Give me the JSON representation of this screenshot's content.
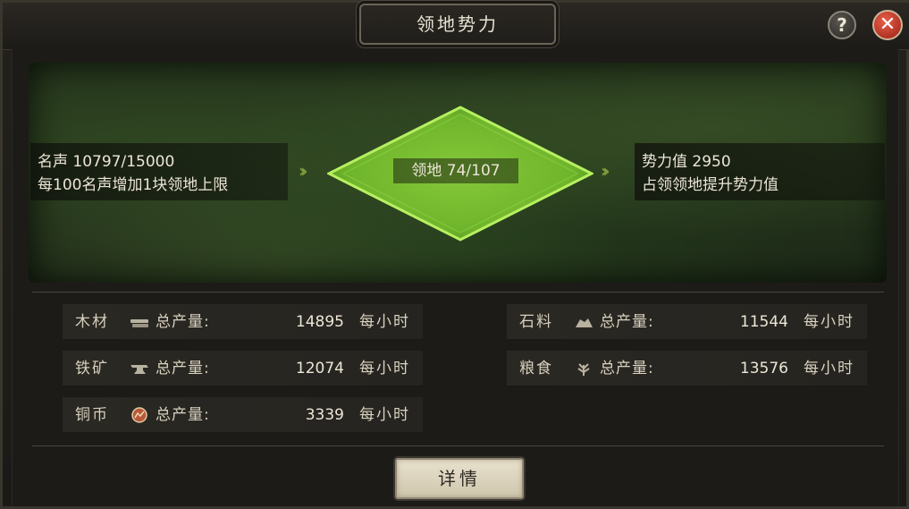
{
  "window": {
    "title": "领地势力",
    "help_label": "?",
    "close_label": "✕"
  },
  "reputation": {
    "line1": "名声 10797/15000",
    "line2": "每100名声增加1块领地上限"
  },
  "territory": {
    "label": "领地 74/107"
  },
  "power": {
    "line1": "势力值 2950",
    "line2": "占领领地提升势力值"
  },
  "resources": [
    {
      "name": "木材",
      "icon": "wood-icon",
      "label": "总产量:",
      "value": "14895",
      "unit": "每小时"
    },
    {
      "name": "石料",
      "icon": "stone-icon",
      "label": "总产量:",
      "value": "11544",
      "unit": "每小时"
    },
    {
      "name": "铁矿",
      "icon": "anvil-icon",
      "label": "总产量:",
      "value": "12074",
      "unit": "每小时"
    },
    {
      "name": "粮食",
      "icon": "grain-icon",
      "label": "总产量:",
      "value": "13576",
      "unit": "每小时"
    },
    {
      "name": "铜币",
      "icon": "coin-icon",
      "label": "总产量:",
      "value": "3339",
      "unit": "每小时"
    }
  ],
  "detail_button": "详情",
  "colors": {
    "territory_green": "#8fd23a",
    "panel_dark": "#1c1b18",
    "text_light": "#ece6d6"
  }
}
